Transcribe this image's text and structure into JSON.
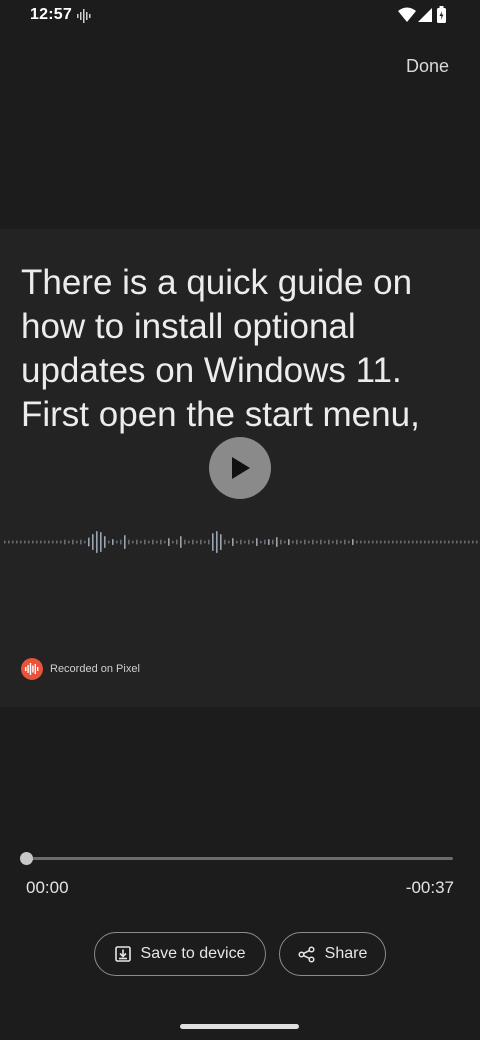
{
  "status_bar": {
    "time": "12:57",
    "recording_icon": "waveform-icon",
    "wifi_icon": "wifi-icon",
    "signal_icon": "cell-signal-icon",
    "battery_icon": "battery-icon"
  },
  "header": {
    "done_label": "Done"
  },
  "clip": {
    "transcript": "There is a quick guide on how to install optional updates on Windows 11. First open the start menu,",
    "play_icon": "play-icon",
    "recorded_label": "Recorded on Pixel",
    "recorder_logo": "recorder-logo-icon"
  },
  "player": {
    "elapsed": "00:00",
    "remaining": "-00:37",
    "progress": 0
  },
  "actions": {
    "save_label": "Save to device",
    "save_icon": "download-icon",
    "share_label": "Share",
    "share_icon": "share-icon"
  },
  "colors": {
    "background": "#1c1c1c",
    "card": "#232323",
    "accent_logo": "#e8533b",
    "play_button": "#8a8a8a"
  }
}
